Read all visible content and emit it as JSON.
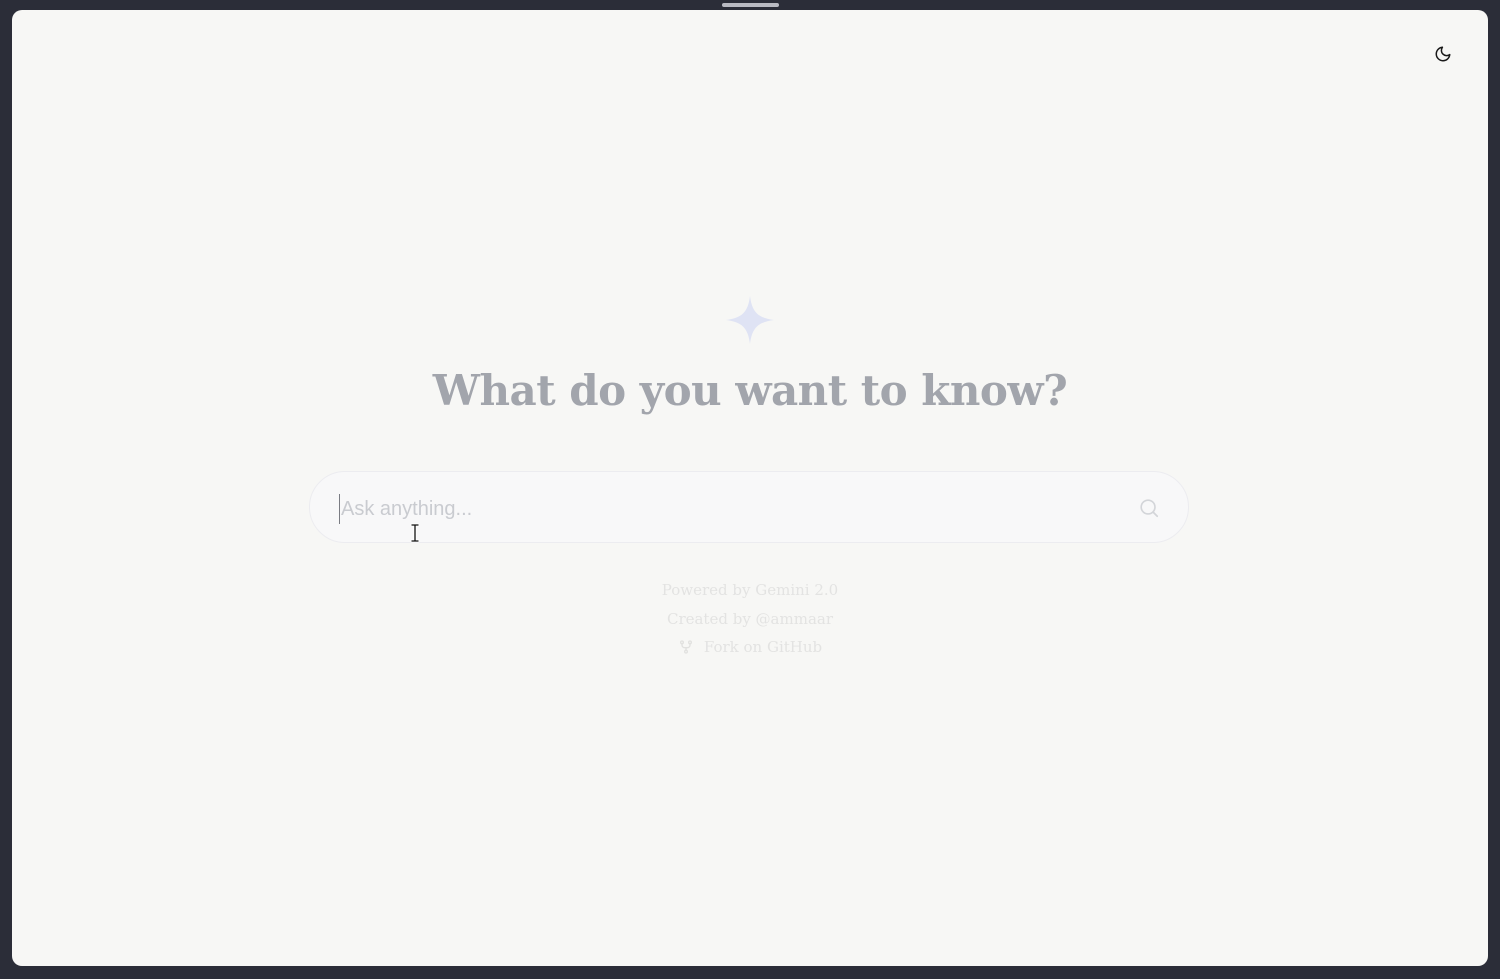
{
  "headline": "What do you want to know?",
  "search": {
    "placeholder": "Ask anything...",
    "value": ""
  },
  "footer": {
    "powered_by": "Powered by Gemini 2.0",
    "created_by": "Created by @ammaar",
    "fork_link": "Fork on GitHub"
  },
  "icons": {
    "theme_toggle": "moon-icon",
    "sparkle": "sparkle-icon",
    "search": "search-icon",
    "fork": "fork-icon"
  },
  "colors": {
    "background": "#f7f7f5",
    "headline": "#a2a5ac",
    "sparkle": "#dfe3f4",
    "footer_text": "#e3e3e2"
  }
}
